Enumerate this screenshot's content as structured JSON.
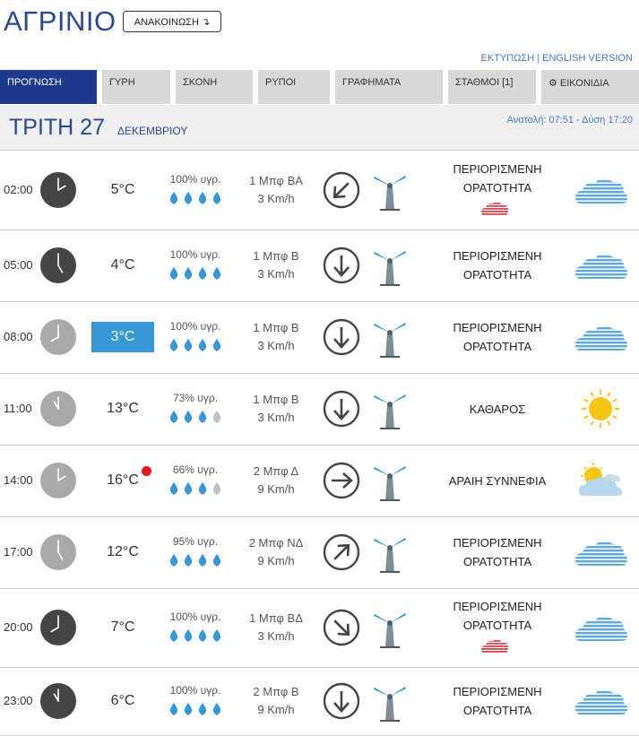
{
  "header": {
    "city": "ΑΓΡΙΝΙΟ",
    "announce_label": "ΑΝΑΚΟΙΝΩΣΗ ↴",
    "print_link": "ΕΚΤΥΠΩΣΗ",
    "separator": "|",
    "english_link": "ENGLISH VERSION"
  },
  "tabs": [
    {
      "label": "ΠΡΟΓΝΩΣΗ",
      "active": true
    },
    {
      "label": "ΓΥΡΗ",
      "active": false
    },
    {
      "label": "ΣΚΟΝΗ",
      "active": false
    },
    {
      "label": "ΡΥΠΟΙ",
      "active": false
    },
    {
      "label": "ΓΡΑΦΗΜΑΤΑ",
      "active": false
    },
    {
      "label": "ΣΤΑΘΜΟΙ  [1]",
      "active": false
    },
    {
      "label": "⚙ ΕΙΚΟΝΙΔΙΑ",
      "active": false
    }
  ],
  "day": {
    "name": "ΤΡΙΤΗ 27",
    "month": "ΔΕΚΕΜΒΡΙΟΥ",
    "sun": "Ανατολή: 07:51  - Δύση 17:20"
  },
  "colors": {
    "brand": "#1e3a8c",
    "title": "#2a4a8b",
    "highlight": "#3598d3",
    "drop": "#3598d3",
    "alert": "#e01b1b"
  },
  "forecast": [
    {
      "time": "02:00",
      "hour": 2,
      "clock_dark": true,
      "temp": "5°C",
      "temp_highlight": false,
      "alert": false,
      "humidity": "100% υγρ.",
      "drops": 4,
      "wind_force": "1 Μπφ ΒΑ",
      "wind_speed": "3 Km/h",
      "wind_icon": "arrow-down-left-icon",
      "sky_line1": "ΠΕΡΙΟΡΙΣΜΕΝΗ",
      "sky_line2": "ΟΡΑΤΟΤΗΤΑ",
      "sky_icon": "fog-icon",
      "warning_cloud": true
    },
    {
      "time": "05:00",
      "hour": 5,
      "clock_dark": true,
      "temp": "4°C",
      "temp_highlight": false,
      "alert": false,
      "humidity": "100% υγρ.",
      "drops": 4,
      "wind_force": "1 Μπφ Β",
      "wind_speed": "3 Km/h",
      "wind_icon": "arrow-down-icon",
      "sky_line1": "ΠΕΡΙΟΡΙΣΜΕΝΗ",
      "sky_line2": "ΟΡΑΤΟΤΗΤΑ",
      "sky_icon": "fog-icon",
      "warning_cloud": false
    },
    {
      "time": "08:00",
      "hour": 8,
      "clock_dark": false,
      "temp": "3°C",
      "temp_highlight": true,
      "alert": false,
      "humidity": "100% υγρ.",
      "drops": 4,
      "wind_force": "1 Μπφ Β",
      "wind_speed": "3 Km/h",
      "wind_icon": "arrow-down-icon",
      "sky_line1": "ΠΕΡΙΟΡΙΣΜΕΝΗ",
      "sky_line2": "ΟΡΑΤΟΤΗΤΑ",
      "sky_icon": "fog-icon",
      "warning_cloud": false
    },
    {
      "time": "11:00",
      "hour": 11,
      "clock_dark": false,
      "temp": "13°C",
      "temp_highlight": false,
      "alert": false,
      "humidity": "73% υγρ.",
      "drops": 3,
      "wind_force": "1 Μπφ Β",
      "wind_speed": "3 Km/h",
      "wind_icon": "arrow-down-icon",
      "sky_line1": "ΚΑΘΑΡΟΣ",
      "sky_line2": "",
      "sky_icon": "sun-icon",
      "warning_cloud": false
    },
    {
      "time": "14:00",
      "hour": 2,
      "clock_dark": false,
      "temp": "16°C",
      "temp_highlight": false,
      "alert": true,
      "humidity": "66% υγρ.",
      "drops": 3,
      "wind_force": "2 Μπφ Δ",
      "wind_speed": "9 Km/h",
      "wind_icon": "arrow-right-icon",
      "sky_line1": "ΑΡΑΙΗ ΣΥΝΝΕΦΙΑ",
      "sky_line2": "",
      "sky_icon": "sun-cloud-icon",
      "warning_cloud": false
    },
    {
      "time": "17:00",
      "hour": 5,
      "clock_dark": false,
      "temp": "12°C",
      "temp_highlight": false,
      "alert": false,
      "humidity": "95% υγρ.",
      "drops": 4,
      "wind_force": "2 Μπφ ΝΔ",
      "wind_speed": "9 Km/h",
      "wind_icon": "arrow-up-right-icon",
      "sky_line1": "ΠΕΡΙΟΡΙΣΜΕΝΗ",
      "sky_line2": "ΟΡΑΤΟΤΗΤΑ",
      "sky_icon": "fog-icon",
      "warning_cloud": false
    },
    {
      "time": "20:00",
      "hour": 8,
      "clock_dark": true,
      "temp": "7°C",
      "temp_highlight": false,
      "alert": false,
      "humidity": "100% υγρ.",
      "drops": 4,
      "wind_force": "1 Μπφ ΒΔ",
      "wind_speed": "3 Km/h",
      "wind_icon": "arrow-down-right-icon",
      "sky_line1": "ΠΕΡΙΟΡΙΣΜΕΝΗ",
      "sky_line2": "ΟΡΑΤΟΤΗΤΑ",
      "sky_icon": "fog-icon",
      "warning_cloud": true
    },
    {
      "time": "23:00",
      "hour": 11,
      "clock_dark": true,
      "temp": "6°C",
      "temp_highlight": false,
      "alert": false,
      "humidity": "100% υγρ.",
      "drops": 4,
      "wind_force": "2 Μπφ Β",
      "wind_speed": "9 Km/h",
      "wind_icon": "arrow-down-icon",
      "sky_line1": "ΠΕΡΙΟΡΙΣΜΕΝΗ",
      "sky_line2": "ΟΡΑΤΟΤΗΤΑ",
      "sky_icon": "fog-icon",
      "warning_cloud": false
    }
  ]
}
